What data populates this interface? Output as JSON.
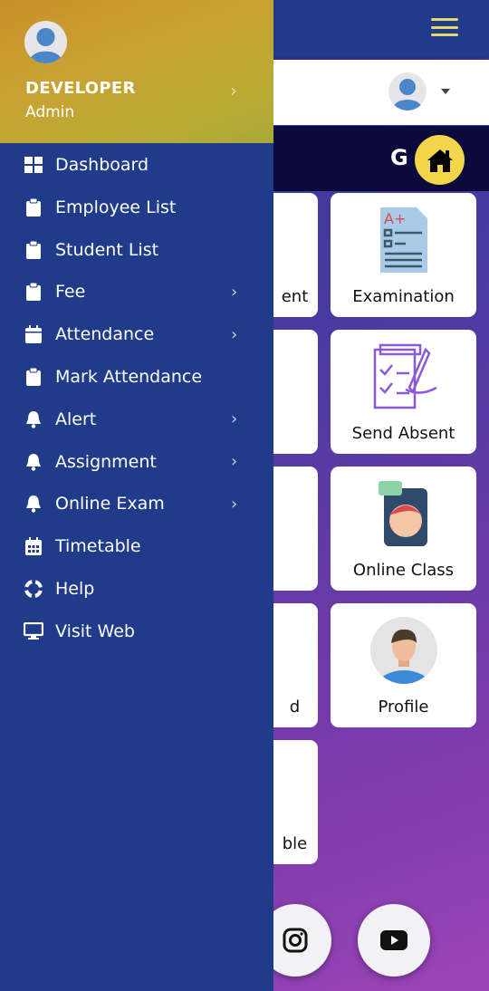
{
  "drawer": {
    "user_name": "DEVELOPER",
    "user_role": "Admin",
    "items": [
      {
        "label": "Dashboard",
        "icon": "dashboard-icon",
        "has_submenu": false
      },
      {
        "label": "Employee List",
        "icon": "clipboard-icon",
        "has_submenu": false
      },
      {
        "label": "Student List",
        "icon": "clipboard-icon",
        "has_submenu": false
      },
      {
        "label": "Fee",
        "icon": "clipboard-icon",
        "has_submenu": true
      },
      {
        "label": "Attendance",
        "icon": "calendar-icon",
        "has_submenu": true
      },
      {
        "label": "Mark Attendance",
        "icon": "clipboard-icon",
        "has_submenu": false
      },
      {
        "label": "Alert",
        "icon": "bell-icon",
        "has_submenu": true
      },
      {
        "label": "Assignment",
        "icon": "bell-icon",
        "has_submenu": true
      },
      {
        "label": "Online Exam",
        "icon": "bell-icon",
        "has_submenu": true
      },
      {
        "label": "Timetable",
        "icon": "calendar-grid-icon",
        "has_submenu": false
      },
      {
        "label": "Help",
        "icon": "lifebuoy-icon",
        "has_submenu": false
      },
      {
        "label": "Visit Web",
        "icon": "monitor-icon",
        "has_submenu": false
      }
    ]
  },
  "header": {
    "g_label": "G"
  },
  "cards_left": [
    "ent",
    "",
    "",
    "d",
    "ble"
  ],
  "cards_right": [
    "Examination",
    "Send Absent",
    "Online Class",
    "Profile"
  ],
  "colors": {
    "drawer": "#1f3b8a",
    "accent": "#f2d54a",
    "dark_bar": "#0b0a3c"
  }
}
